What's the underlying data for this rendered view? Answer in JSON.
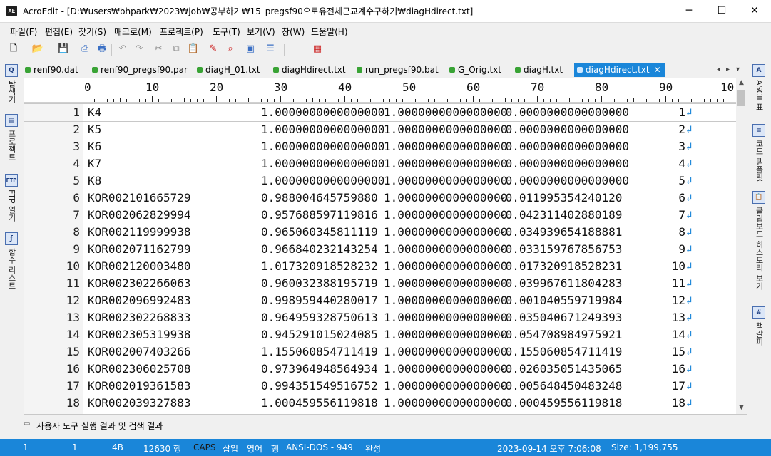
{
  "window": {
    "app_icon": "AE",
    "title": "AcroEdit - [D:₩users₩bhpark₩2023₩job₩공부하기₩15_pregsf90으로유전체근교계수구하기₩diagHdirect.txt]",
    "minimize": "─",
    "maximize": "☐",
    "close": "✕"
  },
  "menu": [
    "파일(F)",
    "편집(E)",
    "찾기(S)",
    "매크로(M)",
    "프로젝트(P)",
    "도구(T)",
    "보기(V)",
    "창(W)",
    "도움말(H)"
  ],
  "toolbar_icons": [
    "new-file-icon",
    "open-folder-icon",
    "save-icon",
    "print-preview-icon",
    "print-icon",
    "undo-icon",
    "redo-icon",
    "cut-icon",
    "copy-icon",
    "paste-icon",
    "highlight-icon",
    "find-icon",
    "window-icon",
    "list-icon",
    "calendar-icon"
  ],
  "left_panel": [
    {
      "icon": "explorer-icon",
      "label": "탐색기"
    },
    {
      "icon": "project-icon",
      "label": "프로젝트"
    },
    {
      "icon": "ftp-icon",
      "label": "FTP 열기"
    },
    {
      "icon": "function-list-icon",
      "label": "함수 리스트"
    }
  ],
  "right_panel": [
    {
      "icon": "ascii-icon",
      "label": "ASCII 표"
    },
    {
      "icon": "code-template-icon",
      "label": "코드 템플릿"
    },
    {
      "icon": "clipboard-icon",
      "label": "클립보드 히스토리 보기"
    },
    {
      "icon": "bookmark-icon",
      "label": "책갈피"
    }
  ],
  "tabs": [
    {
      "label": "renf90.dat",
      "active": false
    },
    {
      "label": "renf90_pregsf90.par",
      "active": false
    },
    {
      "label": "diagH_01.txt",
      "active": false
    },
    {
      "label": "diagHdirect.txt",
      "active": false
    },
    {
      "label": "run_pregsf90.bat",
      "active": false
    },
    {
      "label": "G_Orig.txt",
      "active": false
    },
    {
      "label": "diagH.txt",
      "active": false
    },
    {
      "label": "diagHdirect.txt",
      "active": true
    }
  ],
  "tab_close": "✕",
  "tab_nav": [
    "◂",
    "▸",
    "▾"
  ],
  "ruler_labels": [
    "0",
    "10",
    "20",
    "30",
    "40",
    "50",
    "60",
    "70",
    "80",
    "90",
    "10"
  ],
  "lines": [
    {
      "n": "1",
      "id": "K4",
      "a": "1.0000000000000000",
      "b": "1.0000000000000000",
      "c": " 0.0000000000000000",
      "k": "1"
    },
    {
      "n": "2",
      "id": "K5",
      "a": "1.0000000000000000",
      "b": "1.0000000000000000",
      "c": " 0.0000000000000000",
      "k": "2"
    },
    {
      "n": "3",
      "id": "K6",
      "a": "1.0000000000000000",
      "b": "1.0000000000000000",
      "c": " 0.0000000000000000",
      "k": "3"
    },
    {
      "n": "4",
      "id": "K7",
      "a": "1.0000000000000000",
      "b": "1.0000000000000000",
      "c": " 0.0000000000000000",
      "k": "4"
    },
    {
      "n": "5",
      "id": "K8",
      "a": "1.0000000000000000",
      "b": "1.0000000000000000",
      "c": " 0.0000000000000000",
      "k": "5"
    },
    {
      "n": "6",
      "id": "KOR002101665729",
      "a": "0.988004645759880",
      "b": "1.0000000000000000",
      "c": "-0.011995354240120",
      "k": "6"
    },
    {
      "n": "7",
      "id": "KOR002062829994",
      "a": "0.957688597119816",
      "b": "1.0000000000000000",
      "c": "-0.042311402880189",
      "k": "7"
    },
    {
      "n": "8",
      "id": "KOR002119999938",
      "a": "0.965060345811119",
      "b": "1.0000000000000000",
      "c": "-0.034939654188881",
      "k": "8"
    },
    {
      "n": "9",
      "id": "KOR002071162799",
      "a": "0.966840232143254",
      "b": "1.0000000000000000",
      "c": "-0.033159767856753",
      "k": "9"
    },
    {
      "n": "10",
      "id": "KOR002120003480",
      "a": "1.017320918528232",
      "b": "1.0000000000000000",
      "c": " 0.017320918528231",
      "k": "10"
    },
    {
      "n": "11",
      "id": "KOR002302266063",
      "a": "0.960032388195719",
      "b": "1.0000000000000000",
      "c": "-0.039967611804283",
      "k": "11"
    },
    {
      "n": "12",
      "id": "KOR002096992483",
      "a": "0.998959440280017",
      "b": "1.0000000000000000",
      "c": "-0.001040559719984",
      "k": "12"
    },
    {
      "n": "13",
      "id": "KOR002302268833",
      "a": "0.964959328750613",
      "b": "1.0000000000000000",
      "c": "-0.035040671249393",
      "k": "13"
    },
    {
      "n": "14",
      "id": "KOR002305319938",
      "a": "0.945291015024085",
      "b": "1.0000000000000000",
      "c": "-0.054708984975921",
      "k": "14"
    },
    {
      "n": "15",
      "id": "KOR002007403266",
      "a": "1.155060854711419",
      "b": "1.0000000000000000",
      "c": " 0.155060854711419",
      "k": "15"
    },
    {
      "n": "16",
      "id": "KOR002306025708",
      "a": "0.973964948564934",
      "b": "1.0000000000000000",
      "c": "-0.026035051435065",
      "k": "16"
    },
    {
      "n": "17",
      "id": "KOR002019361583",
      "a": "0.994351549516752",
      "b": "1.0000000000000000",
      "c": "-0.005648450483248",
      "k": "17"
    },
    {
      "n": "18",
      "id": "KOR002039327883",
      "a": "1.000459556119818",
      "b": "1.0000000000000000",
      "c": " 0.000459556119818",
      "k": "18"
    }
  ],
  "eol_marker": "↲",
  "output_tab": "사용자 도구 실행 결과 및 검색 결과",
  "status": {
    "line": "1",
    "col": "1",
    "bytes": "4B",
    "total_lines": "12630 행",
    "caps": "CAPS",
    "insert": "삽입",
    "lang": "영어",
    "row_mode": "행",
    "encoding": "ANSI-DOS - 949",
    "state": "완성",
    "datetime": "2023-09-14 오후 7:06:08",
    "size": "Size: 1,199,755"
  },
  "colors": {
    "accent": "#1a86d9",
    "tab_dot": "#39a335",
    "eol": "#1a86d9"
  }
}
